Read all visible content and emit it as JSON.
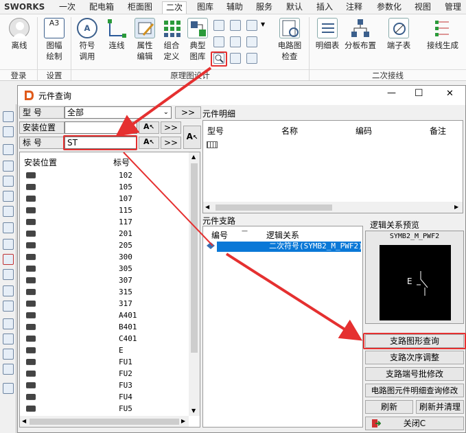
{
  "app_name": "SWORKS",
  "menu_tabs": [
    "一次",
    "配电箱",
    "柜面图",
    "二次",
    "图库",
    "辅助",
    "服务",
    "默认",
    "插入",
    "注释",
    "参数化",
    "视图",
    "管理"
  ],
  "ribbon": {
    "login_label": "离线",
    "frame_label_1": "图幅",
    "frame_label_2": "绘制",
    "symbol_label_1": "符号",
    "symbol_label_2": "调用",
    "wire_label": "连线",
    "attr_label_1": "属性",
    "attr_label_2": "编辑",
    "combo_label_1": "组合",
    "combo_label_2": "定义",
    "typical_label_1": "典型",
    "typical_label_2": "图库",
    "check_label_1": "电路图",
    "check_label_2": "检查",
    "detail_label": "明细表",
    "layout_label": "分板布置",
    "terminal_label": "端子表",
    "wiring_label": "接线生成",
    "group_login": "登录",
    "group_settings": "设置",
    "group_schematic": "原理图设计",
    "group_secondary": "二次接线",
    "frame_icon_text": "A3"
  },
  "dialog": {
    "title": "元件查询",
    "type_label": "型    号",
    "type_value": "全部",
    "location_label": "安装位置",
    "location_value": "",
    "tag_label": "标    号",
    "tag_value": "ST",
    "arrow_btn": ">>",
    "detail_title": "元件明细",
    "detail_cols": [
      "型号",
      "名称",
      "编码",
      "备注"
    ],
    "list_cols": [
      "安装位置",
      "标号"
    ],
    "tags": [
      "102",
      "105",
      "107",
      "115",
      "117",
      "201",
      "205",
      "300",
      "305",
      "307",
      "315",
      "317",
      "A401",
      "B401",
      "C401",
      "E",
      "FU1",
      "FU2",
      "FU3",
      "FU4",
      "FU5"
    ],
    "branch_title": "元件支路",
    "branch_cols": [
      "编号",
      "逻辑关系"
    ],
    "branch_row": "二次符号(SYMB2_M_PWF2)",
    "preview_title": "逻辑关系预览",
    "preview_name": "SYMB2_M_PWF2",
    "preview_symbol_label": "E",
    "btn_graph_query": "支路图形查询",
    "btn_order": "支路次序调整",
    "btn_terminal_batch": "支路端号批修改",
    "btn_circuit_detail": "电路图元件明细查询修改",
    "btn_refresh": "刷新",
    "btn_refresh_clean": "刷新并清理",
    "btn_close": "关闭C",
    "win_min": "—",
    "win_max": "☐",
    "win_close": "✕"
  },
  "colors": {
    "highlight": "#e53030",
    "selection": "#0a78d7"
  }
}
